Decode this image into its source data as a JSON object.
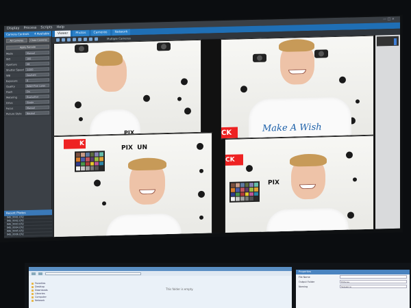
{
  "app": {
    "menu": [
      "Display",
      "Process",
      "Scripts",
      "Help"
    ],
    "window_controls": "—  □  ×"
  },
  "tabs": [
    "Viewer",
    "Photos",
    "Cameras",
    "Network"
  ],
  "toolbar": {
    "zoom_label": "Multiple Cameras"
  },
  "sidebar": {
    "title": "Camera Controls",
    "count": "4 Available",
    "buttons": [
      "All Cameras",
      "Close Cameras",
      "Apply Remote"
    ],
    "rows": [
      {
        "label": "Mode",
        "value": "Manual"
      },
      {
        "label": "ISO",
        "value": "100"
      },
      {
        "label": "Aperture",
        "value": "f/8"
      },
      {
        "label": "Shutter Speed",
        "value": "1/200"
      },
      {
        "label": "WB",
        "value": "Daylight"
      },
      {
        "label": "Exposure",
        "value": "0"
      },
      {
        "label": "Quality",
        "value": "RAW+Fine Large"
      },
      {
        "label": "Flash",
        "value": "On"
      },
      {
        "label": "Metering",
        "value": "Evaluative"
      },
      {
        "label": "Drive",
        "value": "Single"
      },
      {
        "label": "Focus",
        "value": "Manual"
      },
      {
        "label": "Picture Style",
        "value": "Neutral"
      }
    ],
    "list_title": "Recent Photos",
    "list_items": [
      "IMG_0001.CR2",
      "IMG_0002.CR2",
      "IMG_0003.CR2",
      "IMG_0004.CR2",
      "IMG_0005.CR2",
      "IMG_0006.CR2"
    ]
  },
  "photos": {
    "brand_left": "PIX",
    "brand_left_suffix": "UN",
    "brand_right": "PIX",
    "red_tag_left": "K",
    "red_tag_right": "CK",
    "shirt_text": "Make A Wish"
  },
  "lower": {
    "folder_items": [
      "Favorites",
      "Desktop",
      "Downloads",
      "Libraries",
      "Computer",
      "Network"
    ],
    "empty_text": "This folder is empty.",
    "props_title": "Properties",
    "props_rows": [
      {
        "label": "File Name",
        "value": ""
      },
      {
        "label": "Output Folder",
        "value": "Pictures"
      },
      {
        "label": "Naming",
        "value": "Sequence"
      }
    ]
  },
  "colors": {
    "accent": "#2a7bc2",
    "shirt_logo": "#1b5fa8",
    "red_tag": "#e22222"
  }
}
